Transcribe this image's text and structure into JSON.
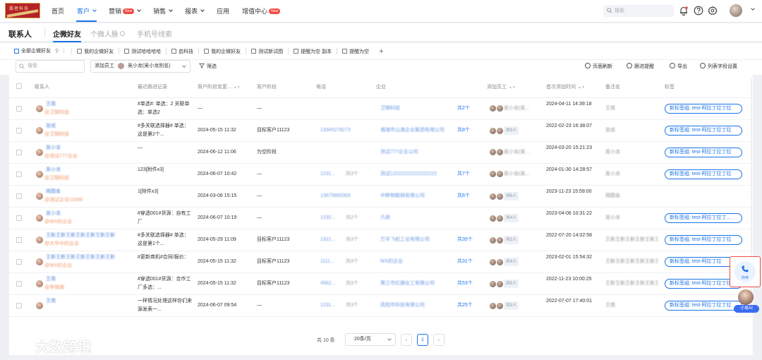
{
  "brand": {
    "logo_text": "霸者科技"
  },
  "nav": {
    "items": [
      {
        "label": "首页",
        "active": false,
        "dropdown": false,
        "badge": ""
      },
      {
        "label": "客户",
        "active": true,
        "dropdown": true,
        "badge": ""
      },
      {
        "label": "营销",
        "active": false,
        "dropdown": true,
        "badge": "New"
      },
      {
        "label": "销售",
        "active": false,
        "dropdown": true,
        "badge": ""
      },
      {
        "label": "报表",
        "active": false,
        "dropdown": true,
        "badge": ""
      },
      {
        "label": "应用",
        "active": false,
        "dropdown": false,
        "badge": ""
      },
      {
        "label": "增值中心",
        "active": false,
        "dropdown": false,
        "badge": "New"
      }
    ],
    "search_placeholder": "搜索",
    "icons": [
      "bell-icon",
      "help-icon",
      "settings-icon"
    ]
  },
  "page": {
    "title": "联系人",
    "tabs": [
      {
        "label": "企微好友",
        "active": true
      },
      {
        "label": "个微人脉",
        "active": false
      },
      {
        "label": "手机号线索",
        "active": false
      }
    ]
  },
  "views": [
    {
      "label": "全部企微好友",
      "active": true
    },
    {
      "label": "我的企微好友",
      "active": false
    },
    {
      "label": "测试哈哈哈哈",
      "active": false
    },
    {
      "label": "启科技",
      "active": false
    },
    {
      "label": "我的企微好友",
      "active": false
    },
    {
      "label": "测试新试图",
      "active": false
    },
    {
      "label": "提醒为空 副本",
      "active": false
    },
    {
      "label": "提醒为空",
      "active": false
    }
  ],
  "toolbar": {
    "search_placeholder": "搜索",
    "employee_label": "添加员工",
    "employee_value": "吴小龙(吴小龙别名)",
    "filter_label": "筛选",
    "refresh_label": "页面刷新",
    "remind_label": "跟进提醒",
    "export_label": "导出",
    "fields_label": "列表字段设置"
  },
  "table": {
    "columns": [
      "联系人",
      "最近跟进记录",
      "客户阶段变更...",
      "客户阶段",
      "电话",
      "企业",
      "添加员工",
      "首次添加时间",
      "备注名",
      "标签"
    ],
    "rows": [
      {
        "name": "王南",
        "org": "@卫锦科技",
        "followup": "#单选#: 单选：2 关联单选：单选2",
        "stage_change": "—",
        "stage": "—",
        "phone": "",
        "phone_count": "",
        "company": "卫锦科技",
        "company_count": "共2个",
        "emp_name": "吴小龙(吴...",
        "emp_tag": "",
        "emp_count": "",
        "first_added": "2024-04-11 14:39:18",
        "remark": "王南",
        "tag": "新标签组: test-阿拉丁拉丁拉"
      },
      {
        "name": "张成",
        "org": "@卫锦科技",
        "followup": "#多关联选择器# 单选：这是第2个...",
        "stage_change": "2024-05-15 11:32",
        "stage": "目标客户11123",
        "phone": "13345278273",
        "phone_count": "",
        "company": "湘海市山海企业集团有限公司",
        "company_count": "共8个",
        "emp_name": "",
        "emp_tag": "共3人",
        "emp_count": "",
        "first_added": "2022-02-23 16:38:07",
        "remark": "张成",
        "tag": "新标签组: test-阿拉丁拉丁拉"
      },
      {
        "name": "吴小龙",
        "org": "@测试777企业",
        "followup": "—",
        "stage_change": "2024-06-12 11:06",
        "stage": "为空阶段",
        "phone": "",
        "phone_count": "",
        "company": "测试777企业公司",
        "company_count": "",
        "emp_name": "吴小龙(吴...",
        "emp_tag": "",
        "emp_count": "",
        "first_added": "2024-03-20 15:21:23",
        "remark": "吴小龙",
        "tag": "新标签组: test-阿拉丁拉丁拉"
      },
      {
        "name": "吴小龙",
        "org": "@卫锦科技",
        "followup": "123[附件x3]",
        "stage_change": "2024-06-07 10:42",
        "stage": "—",
        "phone": "1231...",
        "phone_count": "共3个",
        "company": "测试12222222222222222",
        "company_count": "共7个",
        "emp_name": "吴小龙(吴...",
        "emp_tag": "",
        "emp_count": "",
        "first_added": "2024-01-30 14:28:57",
        "remark": "吴小龙",
        "tag": "新标签组: test-阿拉丁拉丁拉"
      },
      {
        "name": "揭圆金",
        "org": "@测试企业10086",
        "followup": "1[附件x3]",
        "stage_change": "2024-03-06 15:15",
        "stage": "—",
        "phone": "13675665303",
        "phone_count": "",
        "company": "中移物联网有限公司",
        "company_count": "共6个",
        "emp_name": "",
        "emp_tag": "共6人",
        "emp_count": "",
        "first_added": "2023-11-23 15:59:00",
        "remark": "揭圆金",
        "tag": ""
      },
      {
        "name": "吴小龙",
        "org": "@WX的企业",
        "followup": "#穿透001#货源：自有工厂",
        "stage_change": "2024-06-07 10:19",
        "stage": "—",
        "phone": "1232...",
        "phone_count": "共2个",
        "company": "凡商",
        "company_count": "",
        "emp_name": "",
        "emp_tag": "共4人",
        "emp_count": "",
        "first_added": "2023-04-06 10:31:22",
        "remark": "吴小龙",
        "tag": "新标签组: test-阿拉丁拉丁..."
      },
      {
        "name": "王新王新王新王新王新王新王新",
        "org": "@大华中的企业",
        "followup": "#多关联选择器# 单选：这是第1个...",
        "stage_change": "2024-05-29 11:09",
        "stage": "目标客户11123",
        "phone": "1321...",
        "phone_count": "共3个",
        "company": "万丰飞机工业有限公司",
        "company_count": "共35个",
        "emp_name": "",
        "emp_tag": "共3人",
        "emp_count": "",
        "first_added": "2022-07-20 14:02:58",
        "remark": "王新王新王新王新王新王新王新",
        "tag": "新标签组: test-阿拉丁拉丁拉"
      },
      {
        "name": "王新王新王新王新王新王新王新",
        "org": "@WX的企业",
        "followup": "#更新商机#合同/报价：",
        "stage_change": "2024-05-15 11:32",
        "stage": "目标客户11123",
        "phone": "1111...",
        "phone_count": "共3个",
        "company": "WX的企业",
        "company_count": "共31个",
        "emp_name": "",
        "emp_tag": "共4人",
        "emp_count": "",
        "first_added": "2023-02-01 15:54:32",
        "remark": "王新王新王新王新王新王新王新",
        "tag": "新标签组: test-阿拉丁拉"
      },
      {
        "name": "王南",
        "org": "@李南南",
        "followup": "#穿透001#货源：合作工厂多选：...",
        "stage_change": "2024-05-15 11:32",
        "stage": "目标客户11123",
        "phone": "4562...",
        "phone_count": "共3个",
        "company": "黄江市红旗化工有限公司",
        "company_count": "共53个",
        "emp_name": "",
        "emp_tag": "共5人",
        "emp_count": "",
        "first_added": "2022-11-23 10:00:25",
        "remark": "王新王新王新王新王新王新王新",
        "tag": "新标签组: test-阿拉丁拉丁拉"
      },
      {
        "name": "王南",
        "org": "",
        "followup": "一样情况处理这样你们来源发表一...",
        "stage_change": "2024-06-07 09:54",
        "stage": "—",
        "phone": "1231...",
        "phone_count": "共3个",
        "company": "高阳市科技有限公司",
        "company_count": "共25个",
        "emp_name": "",
        "emp_tag": "共3人",
        "emp_count": "",
        "first_added": "2022-07-07 17:40:01",
        "remark": "王南",
        "tag": "新标签组: test-阿拉丁拉丁拉"
      }
    ]
  },
  "pagination": {
    "total": "共 10 条",
    "page_size": "20条/页",
    "current": "1",
    "prev": "‹",
    "next": "›"
  },
  "float": {
    "call_label": "外呼",
    "ai_label": "小易AI"
  },
  "watermark": {
    "text": "大数跨境"
  },
  "colors": {
    "accent": "#1a73e8",
    "danger": "#f04b47",
    "brand": "#b2242a"
  }
}
